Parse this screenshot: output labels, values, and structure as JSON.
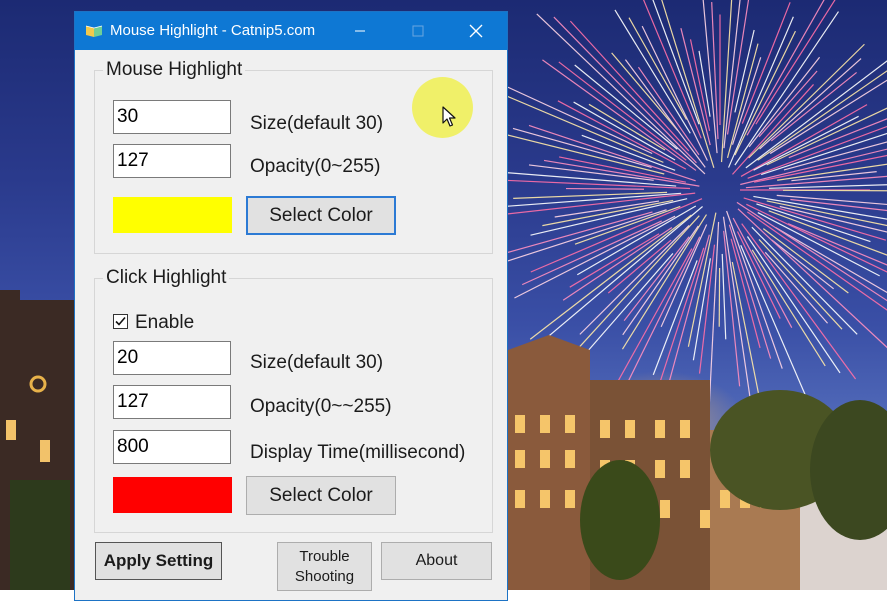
{
  "window": {
    "title": "Mouse Highlight - Catnip5.com",
    "icon": "app-book-icon"
  },
  "mouse_highlight": {
    "group_title": "Mouse Highlight",
    "size_value": "30",
    "size_label": "Size(default 30)",
    "opacity_value": "127",
    "opacity_label": "Opacity(0~255)",
    "color": "#ffff00",
    "select_color_label": "Select Color"
  },
  "click_highlight": {
    "group_title": "Click Highlight",
    "enable_label": "Enable",
    "enable_checked": true,
    "size_value": "20",
    "size_label": "Size(default 30)",
    "opacity_value": "127",
    "opacity_label": "Opacity(0~~255)",
    "display_time_value": "800",
    "display_time_label": "Display Time(millisecond)",
    "color": "#ff0000",
    "select_color_label": "Select Color"
  },
  "footer": {
    "apply_label": "Apply Setting",
    "trouble_label_line1": "Trouble",
    "trouble_label_line2": "Shooting",
    "about_label": "About"
  },
  "colors": {
    "titlebar": "#0e78d4",
    "window_bg": "#f0f0f0",
    "highlight": "#f0f03c"
  }
}
